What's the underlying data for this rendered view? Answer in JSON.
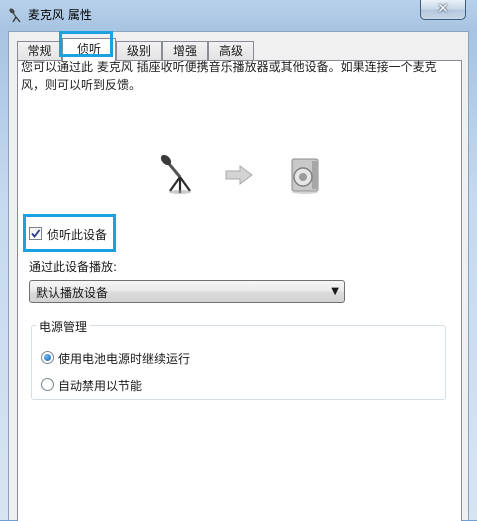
{
  "window": {
    "title": "麦克风 属性",
    "close_glyph": "✕"
  },
  "tabs": [
    {
      "label": "常规",
      "active": false
    },
    {
      "label": "侦听",
      "active": true
    },
    {
      "label": "级别",
      "active": false
    },
    {
      "label": "增强",
      "active": false
    },
    {
      "label": "高级",
      "active": false
    }
  ],
  "listen": {
    "description": "您可以通过此 麦克风 插座收听便携音乐播放器或其他设备。如果连接一个麦克风，则可以听到反馈。",
    "checkbox_label": "侦听此设备",
    "checkbox_checked": true,
    "playback_label": "通过此设备播放:",
    "playback_selected": "默认播放设备"
  },
  "power": {
    "group_label": "电源管理",
    "options": [
      {
        "label": "使用电池电源时继续运行",
        "selected": true
      },
      {
        "label": "自动禁用以节能",
        "selected": false
      }
    ]
  },
  "icons": [
    "microphone-icon",
    "arrow-right-icon",
    "speaker-icon"
  ],
  "colors": {
    "highlight": "#1aa1e2",
    "titlebar": "#b9d1ea"
  }
}
